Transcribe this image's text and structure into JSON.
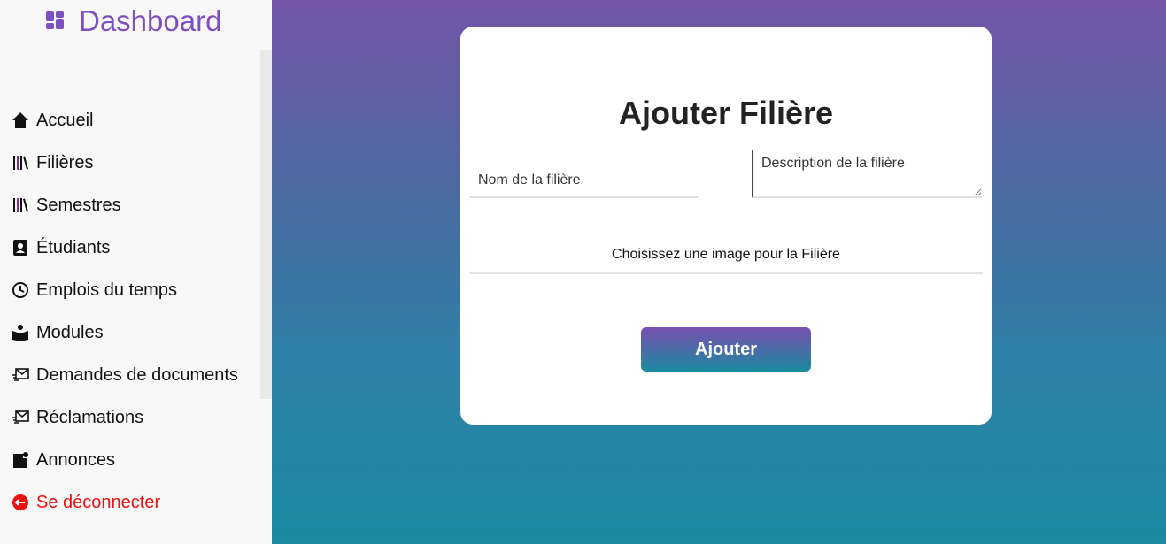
{
  "brand": {
    "title": "Dashboard",
    "icon": "dashboard-grid-icon",
    "color": "#7d4fc0"
  },
  "sidebar": {
    "items": [
      {
        "label": "Accueil",
        "icon": "home-icon"
      },
      {
        "label": "Filières",
        "icon": "books-icon"
      },
      {
        "label": "Semestres",
        "icon": "books-icon"
      },
      {
        "label": "Étudiants",
        "icon": "student-badge-icon"
      },
      {
        "label": "Emplois du temps",
        "icon": "clock-icon"
      },
      {
        "label": "Modules",
        "icon": "reading-book-icon"
      },
      {
        "label": "Demandes de documents",
        "icon": "send-mail-icon"
      },
      {
        "label": "Réclamations",
        "icon": "send-mail-icon"
      },
      {
        "label": "Annonces",
        "icon": "notification-icon"
      },
      {
        "label": "Se déconnecter",
        "icon": "logout-icon",
        "color": "#ee1111"
      }
    ]
  },
  "form": {
    "title": "Ajouter Filière",
    "name_placeholder": "Nom de la filière",
    "description_placeholder": "Description de la filière",
    "file_label": "Choisissez une image pour la Filière",
    "submit_label": "Ajouter"
  },
  "colors": {
    "gradient_top": "#7354a9",
    "gradient_bottom": "#1a8ba1",
    "logout": "#ee1111"
  }
}
